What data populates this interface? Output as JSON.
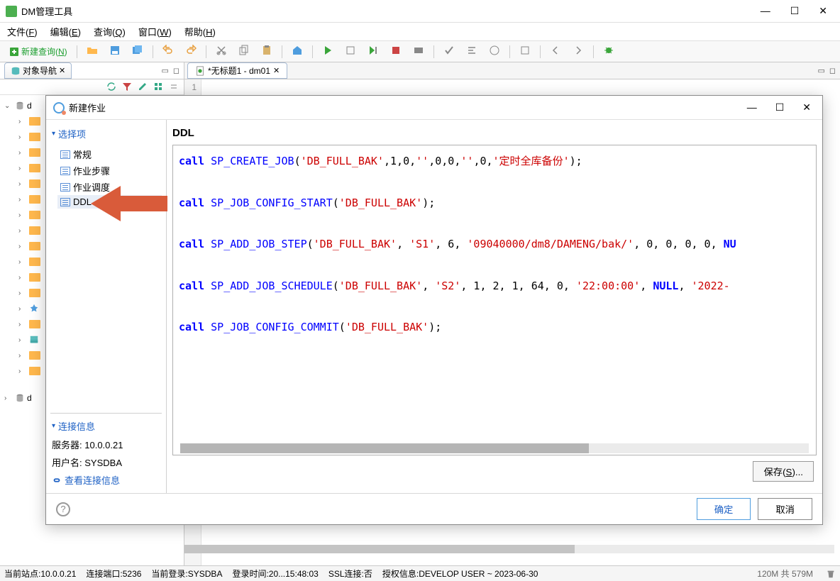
{
  "window": {
    "title": "DM管理工具",
    "minimize": "—",
    "maximize": "☐",
    "close": "✕"
  },
  "menu": {
    "file": "文件(F)",
    "edit": "编辑(E)",
    "query": "查询(Q)",
    "window": "窗口(W)",
    "help": "帮助(H)"
  },
  "toolbar": {
    "new_query": "新建查询(N)"
  },
  "nav_panel": {
    "tab": "对象导航",
    "tree_root": "d"
  },
  "editor": {
    "tab": "*无标题1 - dm01",
    "line": "1"
  },
  "dialog": {
    "title": "新建作业",
    "section_select": "选择项",
    "options": {
      "general": "常规",
      "steps": "作业步骤",
      "schedule": "作业调度",
      "ddl": "DDL"
    },
    "section_conn": "连接信息",
    "conn": {
      "server_label": "服务器:",
      "server_value": "10.0.0.21",
      "user_label": "用户名:",
      "user_value": "SYSDBA",
      "link": "查看连接信息"
    },
    "heading": "DDL",
    "sql": {
      "l1_kw": "call",
      "l1_fn": "SP_CREATE_JOB",
      "l1_s1": "'DB_FULL_BAK'",
      "l1_mid": ",1,0,",
      "l1_s2": "''",
      "l1_mid2": ",0,0,",
      "l1_s3": "''",
      "l1_mid3": ",0,",
      "l1_s4": "'定时全库备份'",
      "l1_end": ");",
      "l2_kw": "call",
      "l2_fn": "SP_JOB_CONFIG_START",
      "l2_s1": "'DB_FULL_BAK'",
      "l2_end": ");",
      "l3_kw": "call",
      "l3_fn": "SP_ADD_JOB_STEP",
      "l3_s1": "'DB_FULL_BAK'",
      "l3_c1": ", ",
      "l3_s2": "'S1'",
      "l3_c2": ", 6, ",
      "l3_s3": "'09040000/dm8/DAMENG/bak/'",
      "l3_c3": ", 0, 0, 0, 0, ",
      "l3_nl": "NU",
      "l4_kw": "call",
      "l4_fn": "SP_ADD_JOB_SCHEDULE",
      "l4_s1": "'DB_FULL_BAK'",
      "l4_c1": ", ",
      "l4_s2": "'S2'",
      "l4_c2": ", 1, 2, 1, 64, 0, ",
      "l4_s3": "'22:00:00'",
      "l4_c3": ", ",
      "l4_nl": "NULL",
      "l4_c4": ", ",
      "l4_s4": "'2022-",
      "l5_kw": "call",
      "l5_fn": "SP_JOB_CONFIG_COMMIT",
      "l5_s1": "'DB_FULL_BAK'",
      "l5_end": ");"
    },
    "save": "保存(S)...",
    "ok": "确定",
    "cancel": "取消",
    "help": "?"
  },
  "status": {
    "site": "当前站点:10.0.0.21",
    "port": "连接端口:5236",
    "login": "当前登录:SYSDBA",
    "time": "登录时间:20...15:48:03",
    "ssl": "SSL连接:否",
    "auth": "授权信息:DEVELOP USER ~ 2023-06-30",
    "mem": "120M 共 579M"
  }
}
